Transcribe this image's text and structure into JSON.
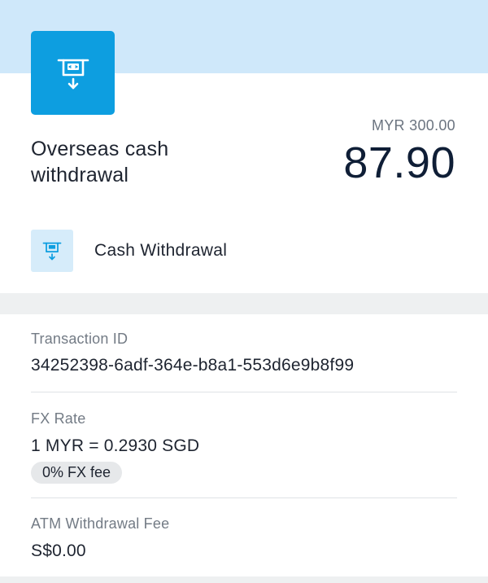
{
  "header": {
    "icon": "atm-withdrawal-icon",
    "title_line1": "Overseas cash",
    "title_line2": "withdrawal",
    "original_amount": "MYR 300.00",
    "amount": "87.90"
  },
  "category": {
    "icon": "atm-withdrawal-icon",
    "label": "Cash Withdrawal"
  },
  "details": {
    "transaction_id_label": "Transaction ID",
    "transaction_id_value": "34252398-6adf-364e-b8a1-553d6e9b8f99",
    "fx_rate_label": "FX Rate",
    "fx_rate_value": "1 MYR = 0.2930 SGD",
    "fx_fee_badge": "0% FX fee",
    "atm_fee_label": "ATM Withdrawal Fee",
    "atm_fee_value": "S$0.00"
  },
  "colors": {
    "top_band": "#cfe8fa",
    "icon_blue": "#0d9ee0",
    "icon_light_bg": "#d6ecfa",
    "amount_text": "#0f1e36"
  }
}
